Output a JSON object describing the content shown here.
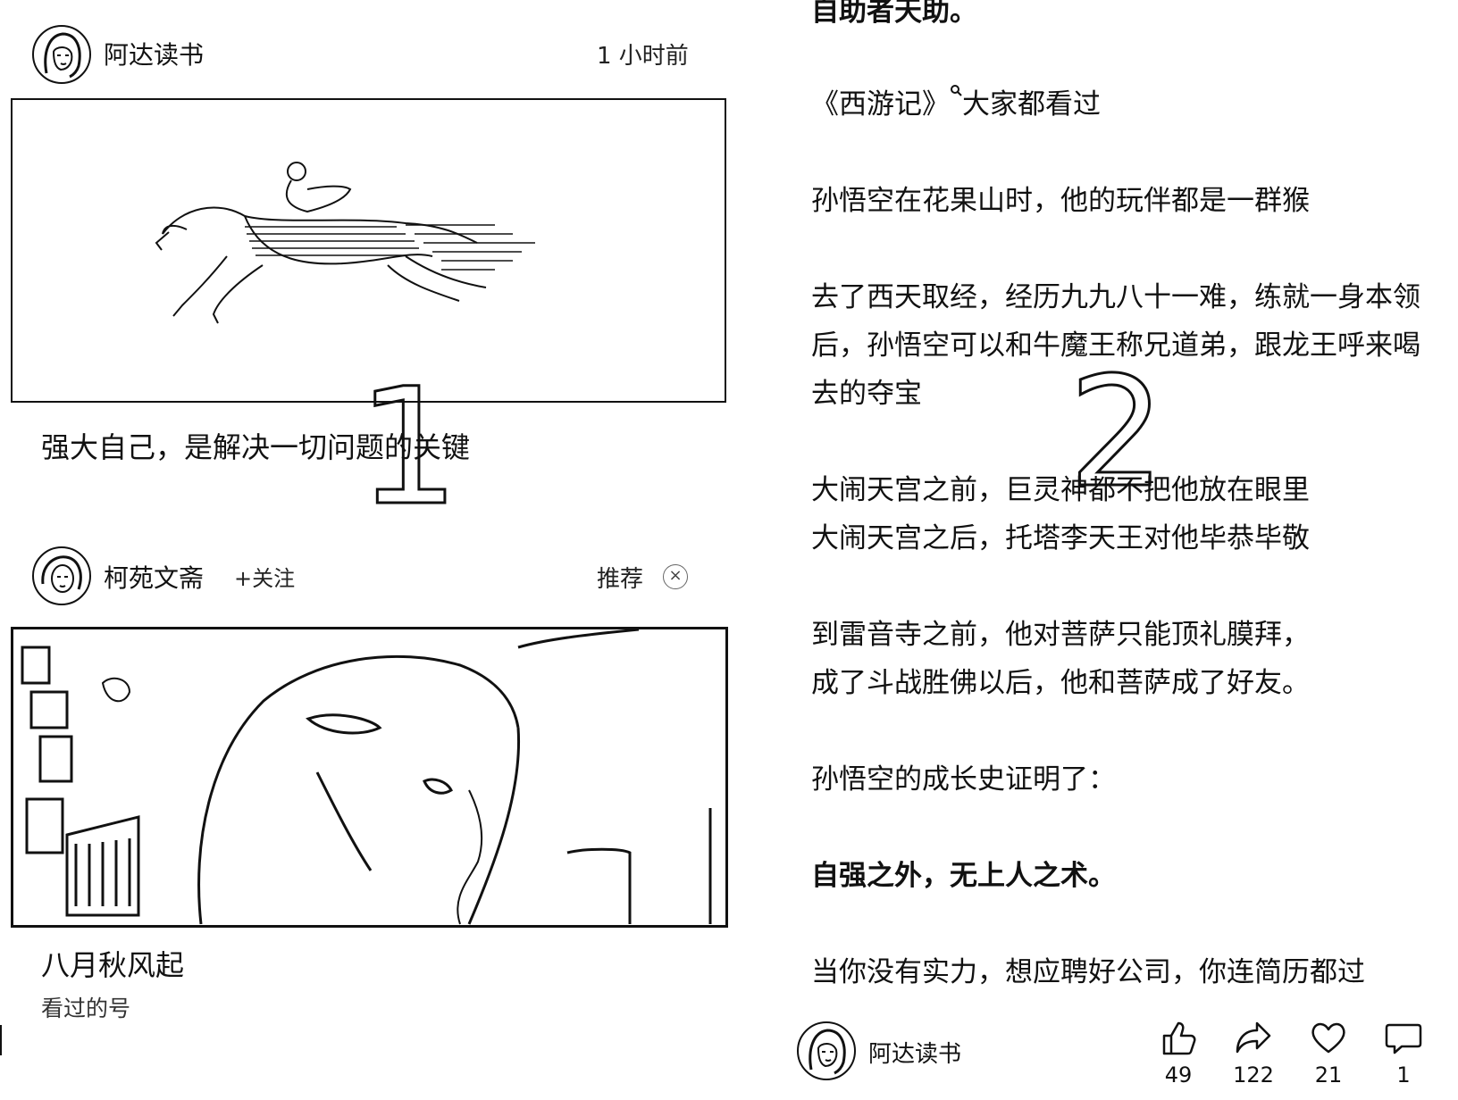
{
  "feed": {
    "post1": {
      "author": "阿达读书",
      "time": "1 小时前",
      "title": "强大自己，是解决一切问题的关键",
      "overlay_number": "1"
    },
    "post2": {
      "author": "柯苑文斋",
      "follow": "+关注",
      "recommend": "推荐",
      "close": "×",
      "title": "八月秋风起",
      "subtitle": "看过的号"
    }
  },
  "article": {
    "overlay_number": "2",
    "paragraphs": [
      {
        "text": "自助者天助。",
        "bold": true
      },
      {
        "pre": "《西游记》",
        "post": "大家都看过",
        "bold": false,
        "has_search": true
      },
      {
        "text": "孙悟空在花果山时，他的玩伴都是一群猴",
        "bold": false
      },
      {
        "text": "去了西天取经，经历九九八十一难，练就一身本领后，孙悟空可以和牛魔王称兄道弟，跟龙王呼来喝去的夺宝",
        "bold": false
      },
      {
        "text": "大闹天宫之前，巨灵神都不把他放在眼里",
        "bold": false
      },
      {
        "text": "大闹天宫之后，托塔李天王对他毕恭毕敬",
        "bold": false
      },
      {
        "text": "到雷音寺之前，他对菩萨只能顶礼膜拜，",
        "bold": false
      },
      {
        "text": "成了斗战胜佛以后，他和菩萨成了好友。",
        "bold": false
      },
      {
        "text": "孙悟空的成长史证明了：",
        "bold": false
      },
      {
        "text": "自强之外，无上人之术。",
        "bold": true
      },
      {
        "text": "当你没有实力，想应聘好公司，你连简历都过",
        "bold": false
      }
    ]
  },
  "footer": {
    "author": "阿达读书",
    "actions": [
      {
        "icon": "thumbs-up-icon",
        "count": "49"
      },
      {
        "icon": "share-icon",
        "count": "122"
      },
      {
        "icon": "heart-icon",
        "count": "21"
      },
      {
        "icon": "comment-icon",
        "count": "1"
      }
    ]
  }
}
